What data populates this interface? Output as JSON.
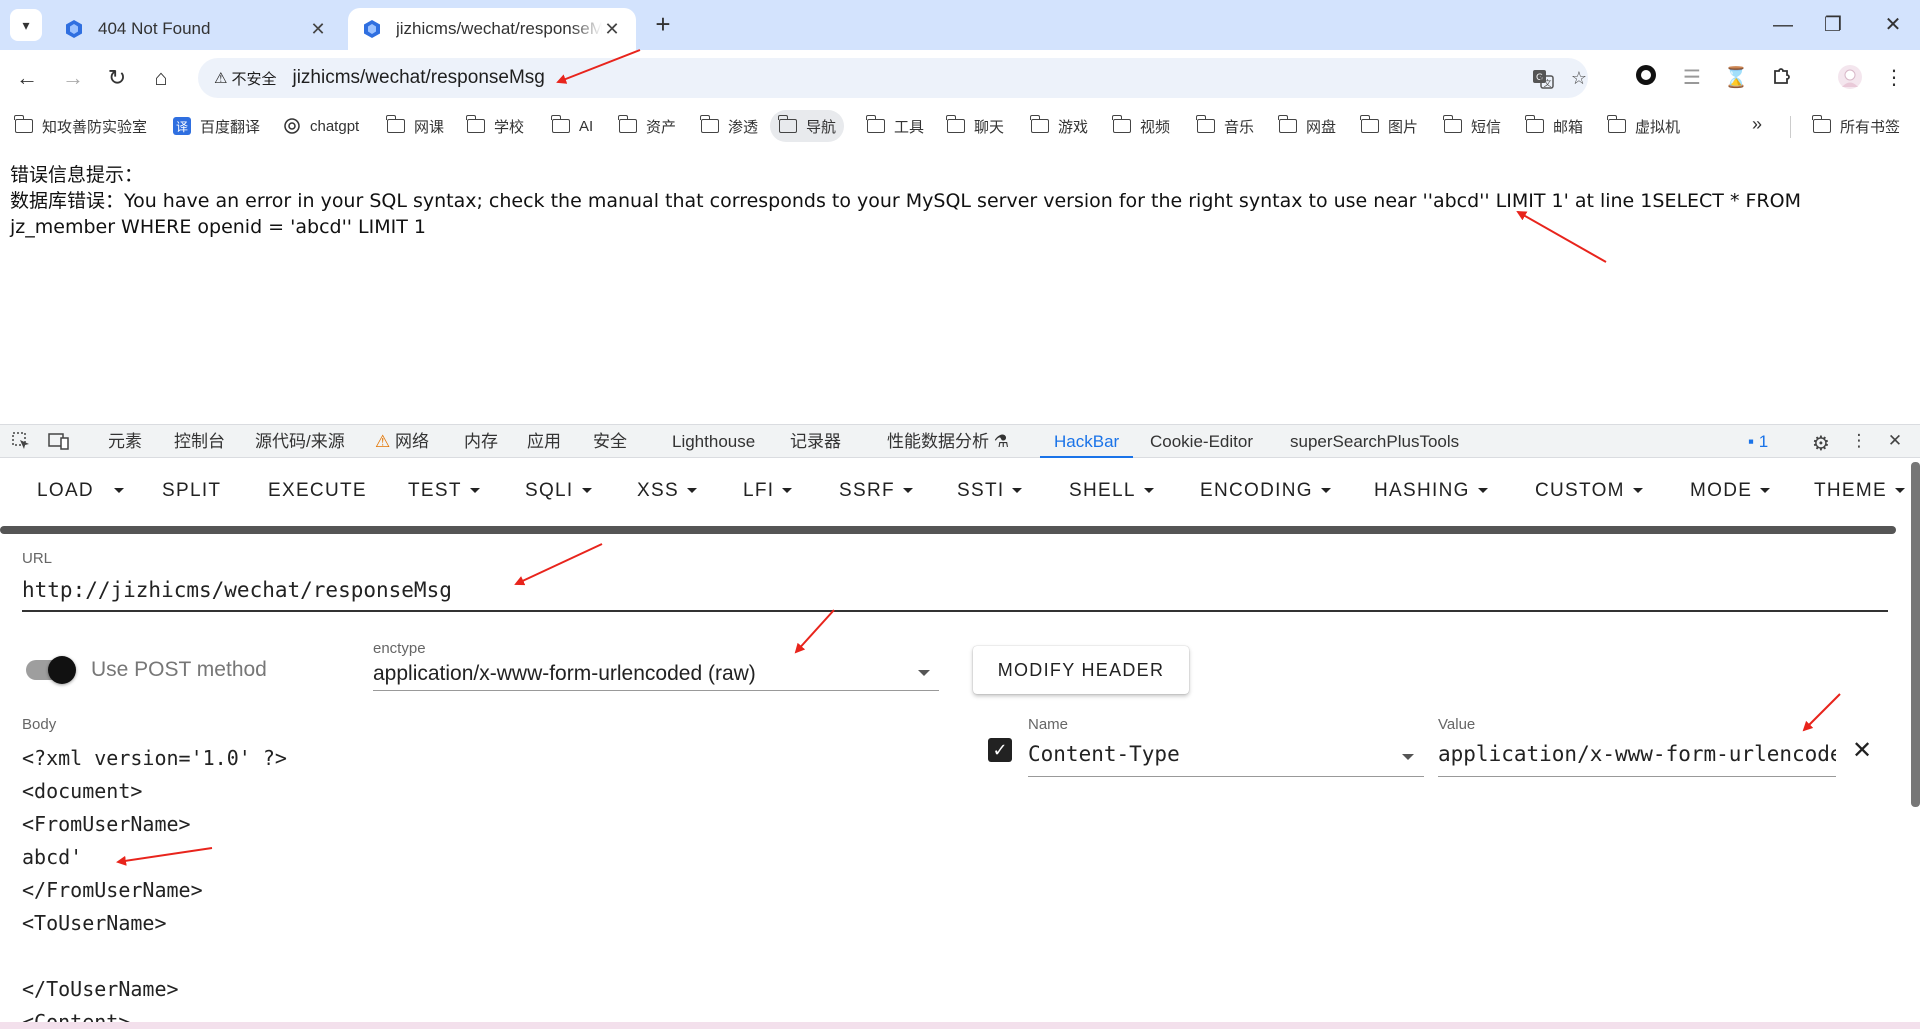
{
  "browser": {
    "tabs": [
      {
        "title": "404 Not Found",
        "active": false
      },
      {
        "title": "jizhicms/wechat/responseMsg",
        "active": true
      }
    ],
    "security_chip": "不安全",
    "address": "jizhicms/wechat/responseMsg"
  },
  "bookmarks": [
    {
      "label": "知攻善防实验室",
      "icon": "folder-icon"
    },
    {
      "label": "百度翻译",
      "icon": "translate-icon"
    },
    {
      "label": "chatgpt",
      "icon": "openai-icon"
    },
    {
      "label": "网课",
      "icon": "folder-icon"
    },
    {
      "label": "学校",
      "icon": "folder-icon"
    },
    {
      "label": "AI",
      "icon": "folder-icon"
    },
    {
      "label": "资产",
      "icon": "folder-icon"
    },
    {
      "label": "渗透",
      "icon": "folder-icon"
    },
    {
      "label": "导航",
      "icon": "folder-icon"
    },
    {
      "label": "工具",
      "icon": "folder-icon"
    },
    {
      "label": "聊天",
      "icon": "folder-icon"
    },
    {
      "label": "游戏",
      "icon": "folder-icon"
    },
    {
      "label": "视频",
      "icon": "folder-icon"
    },
    {
      "label": "音乐",
      "icon": "folder-icon"
    },
    {
      "label": "网盘",
      "icon": "folder-icon"
    },
    {
      "label": "图片",
      "icon": "folder-icon"
    },
    {
      "label": "短信",
      "icon": "folder-icon"
    },
    {
      "label": "邮箱",
      "icon": "folder-icon"
    },
    {
      "label": "虚拟机",
      "icon": "folder-icon"
    }
  ],
  "bookmarks_all": "所有书签",
  "page": {
    "line1": "错误信息提示：",
    "line2": "数据库错误：You have an error in your SQL syntax; check the manual that corresponds to your MySQL server version for the right syntax to use near ''abcd'' LIMIT 1' at line 1SELECT * FROM",
    "line3": "jz_member WHERE openid = 'abcd'' LIMIT 1"
  },
  "devtools": {
    "tabs": [
      "元素",
      "控制台",
      "源代码/来源",
      "网络",
      "内存",
      "应用",
      "安全",
      "Lighthouse",
      "记录器",
      "性能数据分析",
      "HackBar",
      "Cookie-Editor",
      "superSearchPlusTools"
    ],
    "selected_tab": "HackBar",
    "issue_count": "1"
  },
  "hackbar": {
    "menu": [
      "LOAD",
      "SPLIT",
      "EXECUTE",
      "TEST",
      "SQLI",
      "XSS",
      "LFI",
      "SSRF",
      "SSTI",
      "SHELL",
      "ENCODING",
      "HASHING",
      "CUSTOM",
      "MODE",
      "THEME"
    ],
    "url_label": "URL",
    "url_value": "http://jizhicms/wechat/responseMsg",
    "post_label": "Use POST method",
    "post_enabled": true,
    "enctype_label": "enctype",
    "enctype_value": "application/x-www-form-urlencoded (raw)",
    "modify_header": "MODIFY HEADER",
    "body_label": "Body",
    "body": "<?xml version='1.0' ?>\n<document>\n<FromUserName>\nabcd'\n</FromUserName>\n<ToUserName>\n\n</ToUserName>\n<Content>",
    "header_name_label": "Name",
    "header_value_label": "Value",
    "header_name": "Content-Type",
    "header_value": "application/x-www-form-urlencoded",
    "header_enabled": true
  },
  "colors": {
    "tabstrip": "#d3e3fd",
    "accent": "#1a73e8",
    "annotation_arrow": "#e8241c"
  }
}
